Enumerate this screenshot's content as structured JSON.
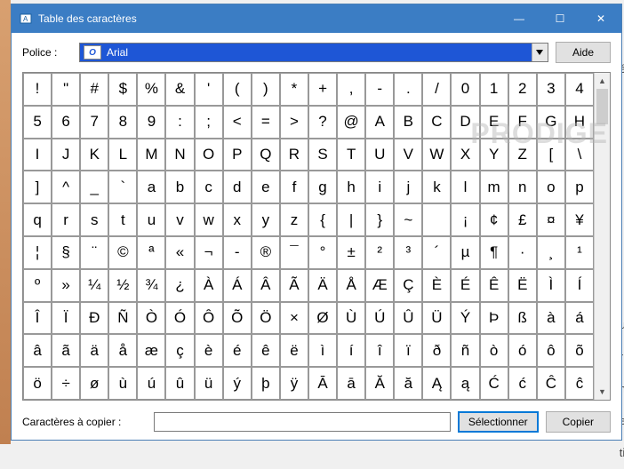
{
  "window": {
    "title": "Table des caractères",
    "minimize": "—",
    "maximize": "☐",
    "close": "✕"
  },
  "toolbar": {
    "font_label": "Police :",
    "font_name": "Arial",
    "font_icon": "O",
    "help_label": "Aide"
  },
  "grid": {
    "rows": [
      [
        "!",
        "\"",
        "#",
        "$",
        "%",
        "&",
        "'",
        "(",
        ")",
        "*",
        "+",
        ",",
        "-",
        ".",
        "/",
        "0",
        "1",
        "2",
        "3",
        "4"
      ],
      [
        "5",
        "6",
        "7",
        "8",
        "9",
        ":",
        ";",
        "<",
        "=",
        ">",
        "?",
        "@",
        "A",
        "B",
        "C",
        "D",
        "E",
        "F",
        "G",
        "H"
      ],
      [
        "I",
        "J",
        "K",
        "L",
        "M",
        "N",
        "O",
        "P",
        "Q",
        "R",
        "S",
        "T",
        "U",
        "V",
        "W",
        "X",
        "Y",
        "Z",
        "[",
        "\\"
      ],
      [
        "]",
        "^",
        "_",
        "`",
        "a",
        "b",
        "c",
        "d",
        "e",
        "f",
        "g",
        "h",
        "i",
        "j",
        "k",
        "l",
        "m",
        "n",
        "o",
        "p"
      ],
      [
        "q",
        "r",
        "s",
        "t",
        "u",
        "v",
        "w",
        "x",
        "y",
        "z",
        "{",
        "|",
        "}",
        "~",
        " ",
        "¡",
        "¢",
        "£",
        "¤",
        "¥"
      ],
      [
        "¦",
        "§",
        "¨",
        "©",
        "ª",
        "«",
        "¬",
        "-",
        "®",
        "¯",
        "°",
        "±",
        "²",
        "³",
        "´",
        "µ",
        "¶",
        "·",
        "¸",
        "¹"
      ],
      [
        "º",
        "»",
        "¼",
        "½",
        "¾",
        "¿",
        "À",
        "Á",
        "Â",
        "Ã",
        "Ä",
        "Å",
        "Æ",
        "Ç",
        "È",
        "É",
        "Ê",
        "Ë",
        "Ì",
        "Í"
      ],
      [
        "Î",
        "Ï",
        "Ð",
        "Ñ",
        "Ò",
        "Ó",
        "Ô",
        "Õ",
        "Ö",
        "×",
        "Ø",
        "Ù",
        "Ú",
        "Û",
        "Ü",
        "Ý",
        "Þ",
        "ß",
        "à",
        "á"
      ],
      [
        "â",
        "ã",
        "ä",
        "å",
        "æ",
        "ç",
        "è",
        "é",
        "ê",
        "ë",
        "ì",
        "í",
        "î",
        "ï",
        "ð",
        "ñ",
        "ò",
        "ó",
        "ô",
        "õ"
      ],
      [
        "ö",
        "÷",
        "ø",
        "ù",
        "ú",
        "û",
        "ü",
        "ý",
        "þ",
        "ÿ",
        "Ā",
        "ā",
        "Ă",
        "ă",
        "Ą",
        "ą",
        "Ć",
        "ć",
        "Ĉ",
        "ĉ"
      ]
    ]
  },
  "footer": {
    "copy_label": "Caractères à copier :",
    "copy_value": "",
    "select_label": "Sélectionner",
    "copy_btn_label": "Copier"
  },
  "scrollbar": {
    "up": "▲",
    "down": "▼"
  },
  "watermark": "PRODIGE"
}
